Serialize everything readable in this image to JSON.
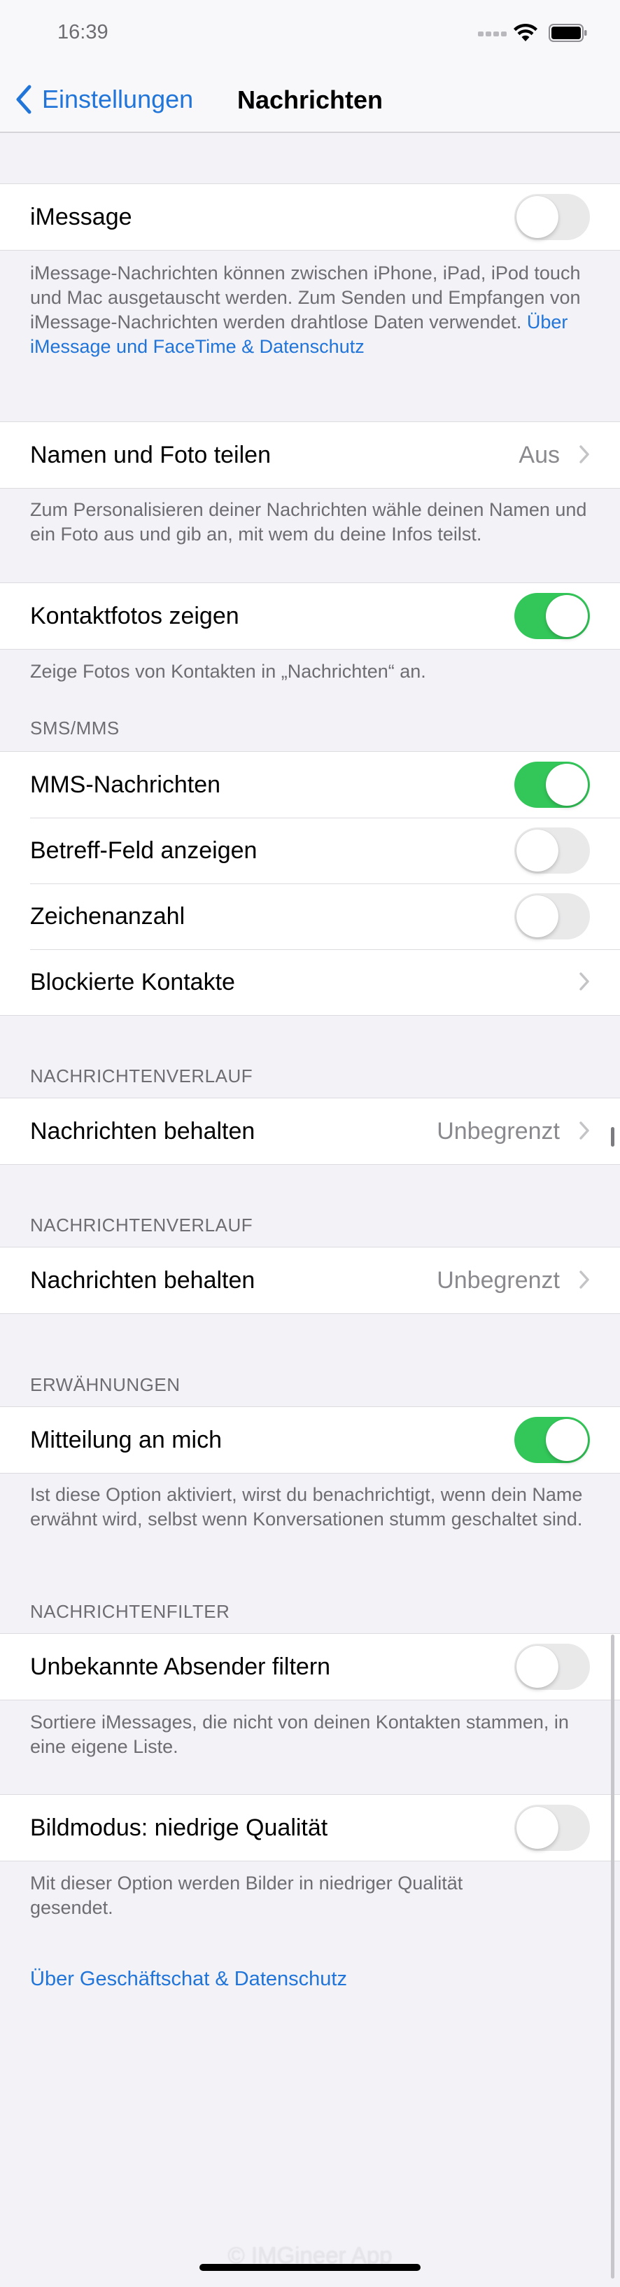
{
  "status_bar": {
    "time": "16:39"
  },
  "nav": {
    "back_label": "Einstellungen",
    "title": "Nachrichten"
  },
  "imessage": {
    "label": "iMessage",
    "enabled": false,
    "footer_text": "iMessage-Nachrichten können zwischen iPhone, iPad, iPod touch und Mac ausgetauscht werden. Zum Senden und Empfangen von iMessage-Nachrichten werden drahtlose Daten verwendet.",
    "footer_link": "Über iMessage und FaceTime & Datenschutz"
  },
  "share_name": {
    "label": "Namen und Foto teilen",
    "value": "Aus",
    "footer": "Zum Personalisieren deiner Nachrichten wähle deinen Namen und ein Foto aus und gib an, mit wem du deine Infos teilst."
  },
  "contact_photos": {
    "label": "Kontaktfotos zeigen",
    "enabled": true,
    "footer": "Zeige Fotos von Kontakten in „Nachrichten“ an."
  },
  "sms_mms": {
    "header": "SMS/MMS",
    "mms": {
      "label": "MMS-Nachrichten",
      "enabled": true
    },
    "subject": {
      "label": "Betreff-Feld anzeigen",
      "enabled": false
    },
    "char_count": {
      "label": "Zeichenanzahl",
      "enabled": false
    },
    "blocked": {
      "label": "Blockierte Kontakte"
    }
  },
  "history_1": {
    "header": "NACHRICHTENVERLAUF",
    "label": "Nachrichten behalten",
    "value": "Unbegrenzt"
  },
  "history_2": {
    "header": "NACHRICHTENVERLAUF",
    "label": "Nachrichten behalten",
    "value": "Unbegrenzt"
  },
  "mentions": {
    "header": "ERWÄHNUNGEN",
    "label": "Mitteilung an mich",
    "enabled": true,
    "footer": "Ist diese Option aktiviert, wirst du benachrichtigt, wenn dein Name erwähnt wird, selbst wenn Konversationen stumm geschaltet sind."
  },
  "filter": {
    "header": "NACHRICHTENFILTER",
    "label": "Unbekannte Absender filtern",
    "enabled": false,
    "footer": "Sortiere iMessages, die nicht von deinen Kontakten stammen, in eine eigene Liste."
  },
  "low_quality": {
    "label": "Bildmodus: niedrige Qualität",
    "enabled": false,
    "footer": "Mit dieser Option werden Bilder in niedriger Qualität gesendet."
  },
  "business_link": "Über Geschäftschat & Datenschutz",
  "watermark": "© IMGineer App",
  "icons": {
    "back": "chevron-left-icon",
    "chevron": "chevron-right-icon",
    "wifi": "wifi-icon",
    "battery": "battery-icon",
    "signal": "cellular-signal-icon"
  },
  "colors": {
    "accent": "#2175d9",
    "toggle_on": "#33c759",
    "toggle_off": "#e9e9ea",
    "background": "#f2f2f7"
  }
}
